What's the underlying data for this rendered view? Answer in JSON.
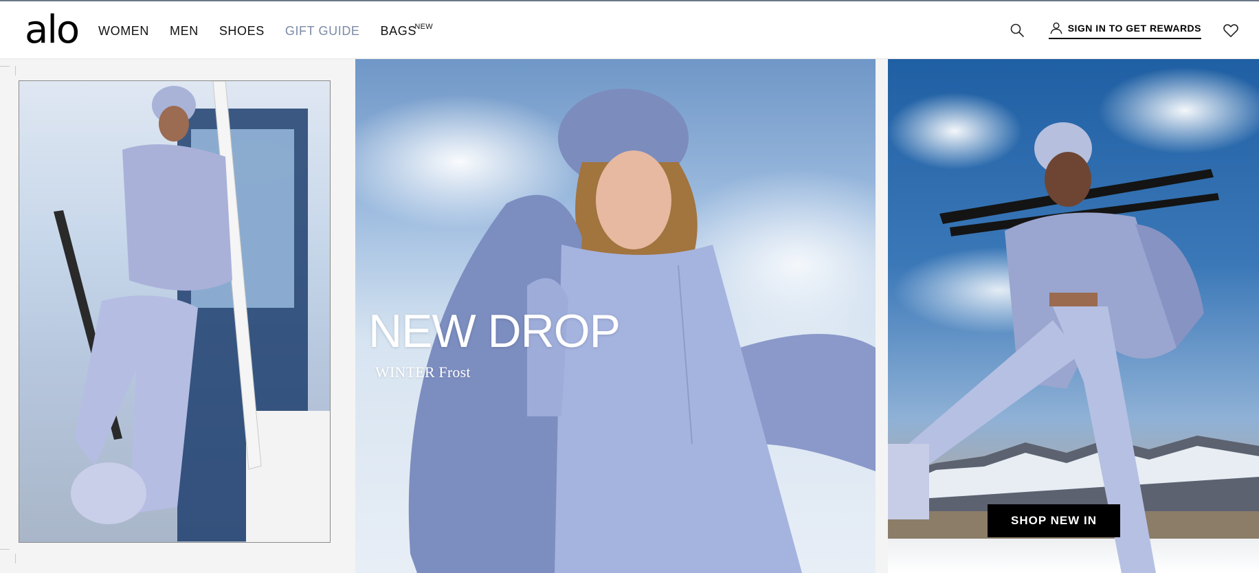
{
  "header": {
    "logo": "alo",
    "nav": [
      {
        "label": "WOMEN"
      },
      {
        "label": "MEN"
      },
      {
        "label": "SHOES"
      },
      {
        "label": "GIFT GUIDE",
        "color": "#7a8aa6"
      },
      {
        "label": "BAGS",
        "badge": "NEW"
      }
    ],
    "search_icon": "search-icon",
    "signin_label": "SIGN IN TO GET REWARDS",
    "user_icon": "user-icon",
    "wishlist_icon": "heart-icon"
  },
  "hero": {
    "title": "NEW DROP",
    "subtitle": "WINTER Frost",
    "cta_label": "SHOP NEW IN",
    "cta_color": "#000000",
    "accent_color": "#7a8aa6"
  }
}
